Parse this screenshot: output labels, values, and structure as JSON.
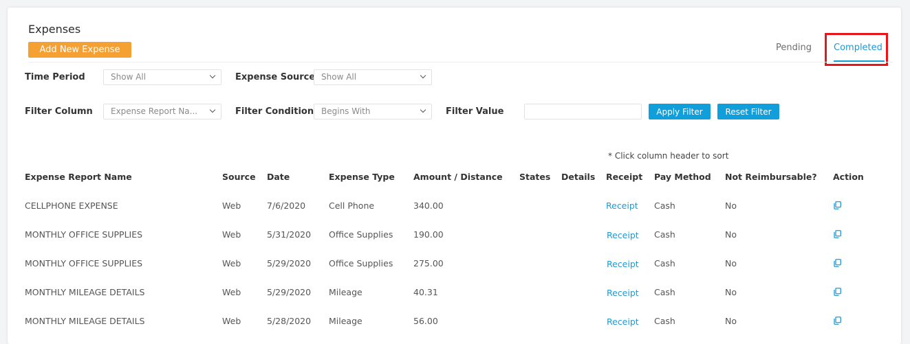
{
  "page": {
    "title": "Expenses",
    "add_button": "Add New Expense",
    "tabs": [
      {
        "label": "Pending"
      },
      {
        "label": "Completed",
        "active": true
      }
    ]
  },
  "filters": {
    "time_period": {
      "label": "Time Period",
      "value": "Show All"
    },
    "expense_source": {
      "label": "Expense Source",
      "value": "Show All"
    },
    "filter_column": {
      "label": "Filter Column",
      "value": "Expense Report Na..."
    },
    "filter_condition": {
      "label": "Filter Condition",
      "value": "Begins With"
    },
    "filter_value": {
      "label": "Filter Value",
      "value": ""
    },
    "apply_button": "Apply Filter",
    "reset_button": "Reset Filter"
  },
  "table": {
    "sort_note": "* Click column header to sort",
    "headers": [
      "Expense Report Name",
      "Source",
      "Date",
      "Expense Type",
      "Amount / Distance",
      "States",
      "Details",
      "Receipt",
      "Pay Method",
      "Not Reimbursable?",
      "Action"
    ],
    "rows": [
      {
        "name": "CELLPHONE EXPENSE",
        "source": "Web",
        "date": "7/6/2020",
        "type": "Cell Phone",
        "amount": "340.00",
        "states": "",
        "details": "",
        "receipt": "Receipt",
        "pay_method": "Cash",
        "not_reimbursable": "No",
        "action_icon": "copy-icon"
      },
      {
        "name": "MONTHLY OFFICE SUPPLIES",
        "source": "Web",
        "date": "5/31/2020",
        "type": "Office Supplies",
        "amount": "190.00",
        "states": "",
        "details": "",
        "receipt": "Receipt",
        "pay_method": "Cash",
        "not_reimbursable": "No",
        "action_icon": "copy-icon"
      },
      {
        "name": "MONTHLY OFFICE SUPPLIES",
        "source": "Web",
        "date": "5/29/2020",
        "type": "Office Supplies",
        "amount": "275.00",
        "states": "",
        "details": "",
        "receipt": "Receipt",
        "pay_method": "Cash",
        "not_reimbursable": "No",
        "action_icon": "copy-icon"
      },
      {
        "name": "MONTHLY MILEAGE DETAILS",
        "source": "Web",
        "date": "5/29/2020",
        "type": "Mileage",
        "amount": "40.31",
        "states": "",
        "details": "",
        "receipt": "Receipt",
        "pay_method": "Cash",
        "not_reimbursable": "No",
        "action_icon": "copy-icon"
      },
      {
        "name": "MONTHLY MILEAGE DETAILS",
        "source": "Web",
        "date": "5/28/2020",
        "type": "Mileage",
        "amount": "56.00",
        "states": "",
        "details": "",
        "receipt": "Receipt",
        "pay_method": "Cash",
        "not_reimbursable": "No",
        "action_icon": "copy-icon"
      }
    ]
  },
  "colors": {
    "accent": "#1a9bd7",
    "button_orange": "#f5a033",
    "button_blue": "#119fdc",
    "highlight_red": "#e8141a"
  }
}
